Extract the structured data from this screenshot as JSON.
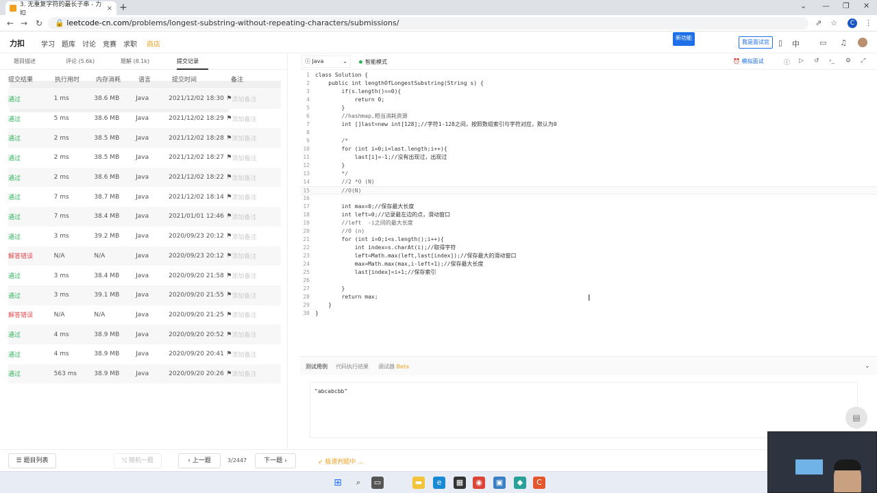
{
  "browser": {
    "tab_title": "3. 无重复字符的最长子串 - 力扣",
    "tab_close": "×",
    "new_tab": "+",
    "url_prefix": "leetcode-cn.com",
    "url_path": "/problems/longest-substring-without-repeating-characters/submissions/",
    "profile_initial": "C"
  },
  "site_nav": {
    "logo": "力扣",
    "items": [
      "学习",
      "题库",
      "讨论",
      "竞赛",
      "求职",
      "商店"
    ],
    "new_feature": "新功能",
    "interviewer": "我是面试官",
    "lang": "中"
  },
  "left_tabs": [
    "题目描述",
    "评论 (5.6k)",
    "题解 (8.1k)",
    "提交记录"
  ],
  "table": {
    "headers": [
      "提交结果",
      "执行用时",
      "内存消耗",
      "语言",
      "提交时间",
      "备注"
    ],
    "rows": [
      {
        "result": "通过",
        "time": "1 ms",
        "mem": "38.6 MB",
        "lang": "Java",
        "date": "2021/12/02 18:30",
        "note": "添加备注",
        "ok": true
      },
      {
        "result": "通过",
        "time": "5 ms",
        "mem": "38.6 MB",
        "lang": "Java",
        "date": "2021/12/02 18:29",
        "note": "添加备注",
        "ok": true
      },
      {
        "result": "通过",
        "time": "2 ms",
        "mem": "38.5 MB",
        "lang": "Java",
        "date": "2021/12/02 18:28",
        "note": "添加备注",
        "ok": true
      },
      {
        "result": "通过",
        "time": "2 ms",
        "mem": "38.5 MB",
        "lang": "Java",
        "date": "2021/12/02 18:27",
        "note": "添加备注",
        "ok": true
      },
      {
        "result": "通过",
        "time": "2 ms",
        "mem": "38.6 MB",
        "lang": "Java",
        "date": "2021/12/02 18:22",
        "note": "添加备注",
        "ok": true
      },
      {
        "result": "通过",
        "time": "7 ms",
        "mem": "38.7 MB",
        "lang": "Java",
        "date": "2021/12/02 18:14",
        "note": "添加备注",
        "ok": true
      },
      {
        "result": "通过",
        "time": "7 ms",
        "mem": "38.4 MB",
        "lang": "Java",
        "date": "2021/01/01 12:46",
        "note": "添加备注",
        "ok": true
      },
      {
        "result": "通过",
        "time": "3 ms",
        "mem": "39.2 MB",
        "lang": "Java",
        "date": "2020/09/23 20:12",
        "note": "添加备注",
        "ok": true
      },
      {
        "result": "解答错误",
        "time": "N/A",
        "mem": "N/A",
        "lang": "Java",
        "date": "2020/09/23 20:12",
        "note": "添加备注",
        "ok": false
      },
      {
        "result": "通过",
        "time": "3 ms",
        "mem": "38.4 MB",
        "lang": "Java",
        "date": "2020/09/20 21:58",
        "note": "添加备注",
        "ok": true
      },
      {
        "result": "通过",
        "time": "3 ms",
        "mem": "39.1 MB",
        "lang": "Java",
        "date": "2020/09/20 21:55",
        "note": "添加备注",
        "ok": true
      },
      {
        "result": "解答错误",
        "time": "N/A",
        "mem": "N/A",
        "lang": "Java",
        "date": "2020/09/20 21:25",
        "note": "添加备注",
        "ok": false
      },
      {
        "result": "通过",
        "time": "4 ms",
        "mem": "38.9 MB",
        "lang": "Java",
        "date": "2020/09/20 20:52",
        "note": "添加备注",
        "ok": true
      },
      {
        "result": "通过",
        "time": "4 ms",
        "mem": "38.9 MB",
        "lang": "Java",
        "date": "2020/09/20 20:41",
        "note": "添加备注",
        "ok": true
      },
      {
        "result": "通过",
        "time": "563 ms",
        "mem": "38.9 MB",
        "lang": "Java",
        "date": "2020/09/20 20:26",
        "note": "添加备注",
        "ok": true
      }
    ]
  },
  "editor": {
    "language": "Java",
    "smart_mode": "智能模式",
    "mock_interview": "模拟面试",
    "lines": [
      "class Solution {",
      "    public int lengthOfLongestSubstring(String s) {",
      "        if(s.length()==0){",
      "            return 0;",
      "        }",
      "        //hashmap,相当消耗资源",
      "        int []last=new int[128];//字符1-128之间，按照数组索引与字符对应，默认为0",
      "",
      "        /*",
      "        for (int i=0;i<last.length;i++){",
      "            last[i]=-1;//没有出现过，出现过",
      "        }",
      "        */",
      "        //2 *O (N)",
      "        //O(N)",
      "",
      "        int max=0;//保存最大长度",
      "        int left=0;//记录最左边的点，滑动窗口",
      "        //left  -i之间的最大长度",
      "        //O (n)",
      "        for (int i=0;i<s.length();i++){",
      "            int index=s.charAt(i);//取得字符",
      "            left=Math.max(left,last[index]);//保存最大的滑动窗口",
      "            max=Math.max(max,i-left+1);//保存最大长度",
      "            last[index]=i+1;//保存索引",
      "",
      "        }",
      "        return max;",
      "    }",
      "}"
    ]
  },
  "bottom": {
    "tabs": [
      "测试用例",
      "代码执行结果",
      "调试器"
    ],
    "beta": "Beta",
    "testcase": "\"abcabcbb\""
  },
  "footer": {
    "problem_list": "题目列表",
    "random": "随机一题",
    "prev": "上一题",
    "count": "3/2447",
    "next": "下一题",
    "judging": "极速判题中 ..."
  }
}
